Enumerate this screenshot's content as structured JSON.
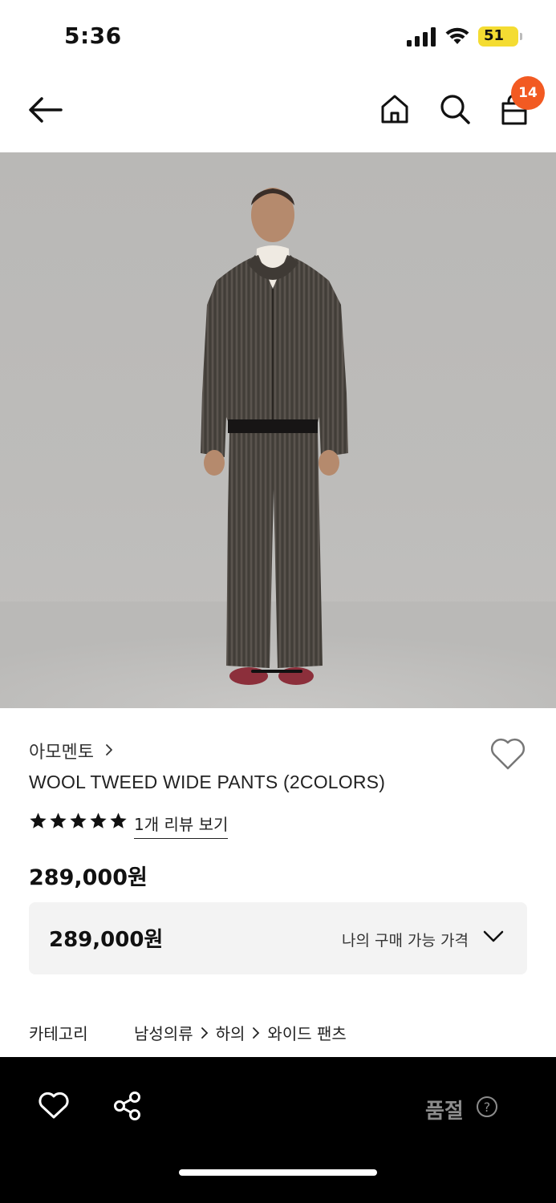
{
  "status_bar": {
    "time": "5:36",
    "battery": "51",
    "battery_color": "#f4dc32"
  },
  "nav": {
    "cart_count": "14",
    "badge_color": "#f25a22",
    "icons": [
      "back-arrow-icon",
      "home-icon",
      "search-icon",
      "shopping-bag-icon"
    ]
  },
  "product": {
    "brand": "아모멘토",
    "name": "WOOL TWEED WIDE PANTS (2COLORS)",
    "rating": 5,
    "rating_max": 5,
    "review_link": "1개 리뷰 보기",
    "price": "289,000원"
  },
  "price_box": {
    "price": "289,000원",
    "label": "나의 구매 가능 가격"
  },
  "category": {
    "label": "카테고리",
    "path": [
      "남성의류",
      "하의",
      "와이드 팬츠"
    ]
  },
  "bottom_bar": {
    "status_label": "품절",
    "icons": [
      "heart-icon",
      "share-icon",
      "help-icon"
    ]
  }
}
